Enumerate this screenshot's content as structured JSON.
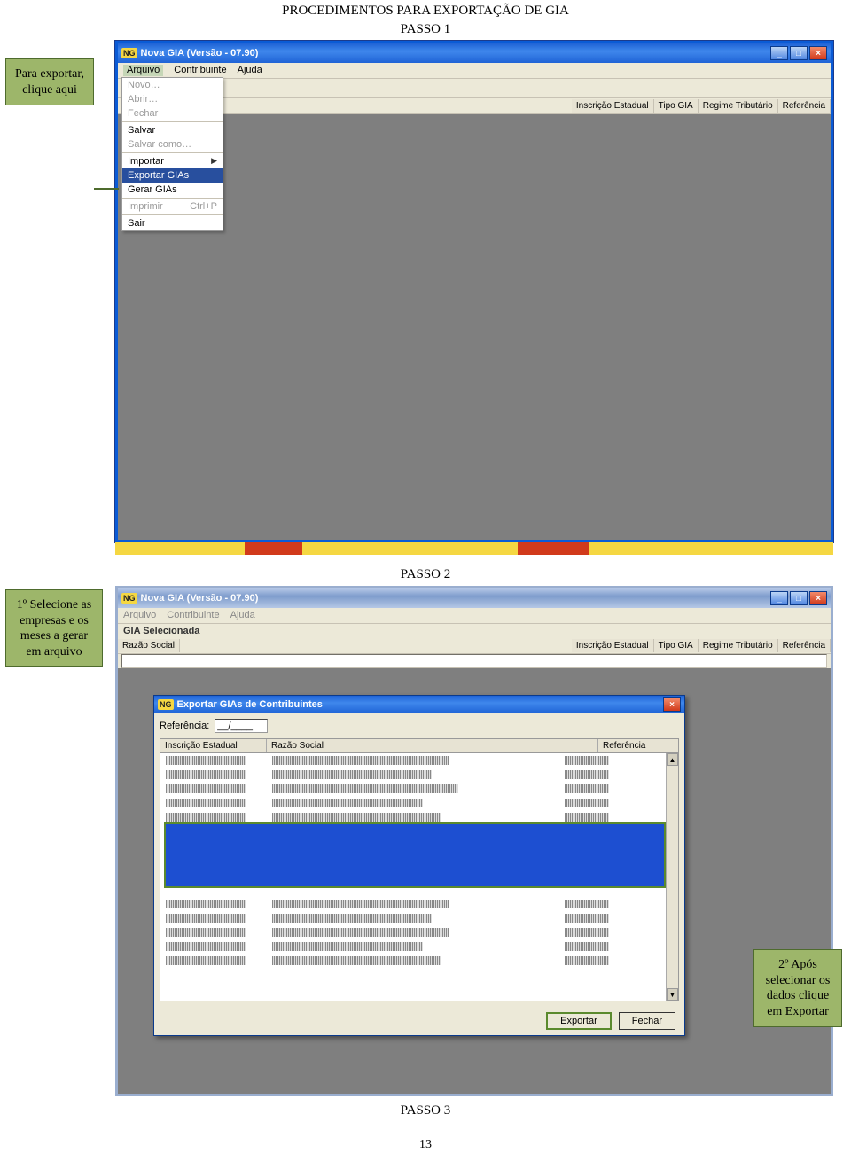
{
  "doc_title": "PROCEDIMENTOS PARA EXPORTAÇÃO DE GIA",
  "step1_label": "PASSO 1",
  "step2_label": "PASSO 2",
  "step3_label": "PASSO 3",
  "page_number": "13",
  "callouts": {
    "c1": "Para exportar, clique aqui",
    "c2": "1º Selecione as empresas e os meses a gerar em arquivo",
    "c3": "2º Após selecionar os dados clique em Exportar"
  },
  "win1": {
    "title": "Nova GIA (Versão - 07.90)",
    "menus": {
      "m1": "Arquivo",
      "m2": "Contribuinte",
      "m3": "Ajuda"
    },
    "cols": {
      "c1": "Inscrição Estadual",
      "c2": "Tipo GIA",
      "c3": "Regime Tributário",
      "c4": "Referência"
    },
    "dropdown": {
      "novo": "Novo…",
      "abrir": "Abrir…",
      "fechar": "Fechar",
      "salvar": "Salvar",
      "salvar_como": "Salvar como…",
      "importar": "Importar",
      "exportar": "Exportar GIAs",
      "gerar": "Gerar GIAs",
      "imprimir": "Imprimir",
      "imprimir_sc": "Ctrl+P",
      "sair": "Sair"
    }
  },
  "win2": {
    "title": "Nova GIA (Versão - 07.90)",
    "menus": {
      "m1": "Arquivo",
      "m2": "Contribuinte",
      "m3": "Ajuda"
    },
    "sub_label": "GIA Selecionada",
    "row_label": "Razão Social",
    "cols": {
      "c1": "Inscrição Estadual",
      "c2": "Tipo GIA",
      "c3": "Regime Tributário",
      "c4": "Referência"
    }
  },
  "dialog": {
    "title": "Exportar GIAs de Contribuintes",
    "ref_label": "Referência:",
    "ref_value": "__/____",
    "headers": {
      "h1": "Inscrição Estadual",
      "h2": "Razão Social",
      "h3": "Referência"
    },
    "btn_export": "Exportar",
    "btn_close": "Fechar"
  }
}
